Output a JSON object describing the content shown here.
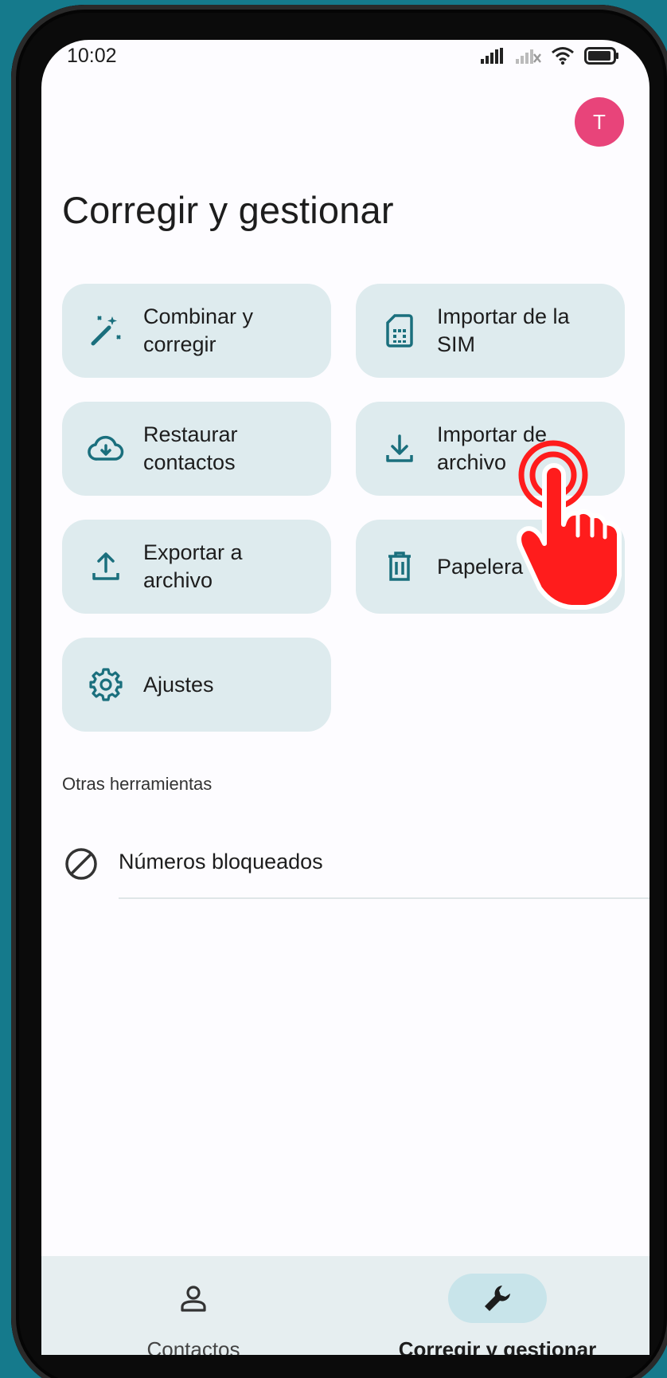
{
  "status_bar": {
    "time": "10:02"
  },
  "header": {
    "avatar_initial": "T",
    "title": "Corregir y gestionar"
  },
  "tools": [
    {
      "label": "Combinar y\ncorregir",
      "icon": "magic-wand-icon"
    },
    {
      "label": "Importar de la\nSIM",
      "icon": "sim-card-icon"
    },
    {
      "label": "Restaurar\ncontactos",
      "icon": "cloud-download-icon"
    },
    {
      "label": "Importar de\narchivo",
      "icon": "download-icon"
    },
    {
      "label": "Exportar a\narchivo",
      "icon": "upload-icon"
    },
    {
      "label": "Papelera",
      "icon": "trash-icon"
    },
    {
      "label": "Ajustes",
      "icon": "gear-icon"
    }
  ],
  "other_tools": {
    "heading": "Otras herramientas",
    "items": [
      {
        "label": "Números bloqueados",
        "icon": "block-icon"
      }
    ]
  },
  "bottom_nav": [
    {
      "label": "Contactos",
      "icon": "person-icon",
      "active": false
    },
    {
      "label": "Corregir y gestionar",
      "icon": "wrench-icon",
      "active": true
    }
  ],
  "colors": {
    "accent": "#1a6f7d",
    "card": "#deebee",
    "avatar": "#e8447a",
    "background": "#157a8c"
  }
}
